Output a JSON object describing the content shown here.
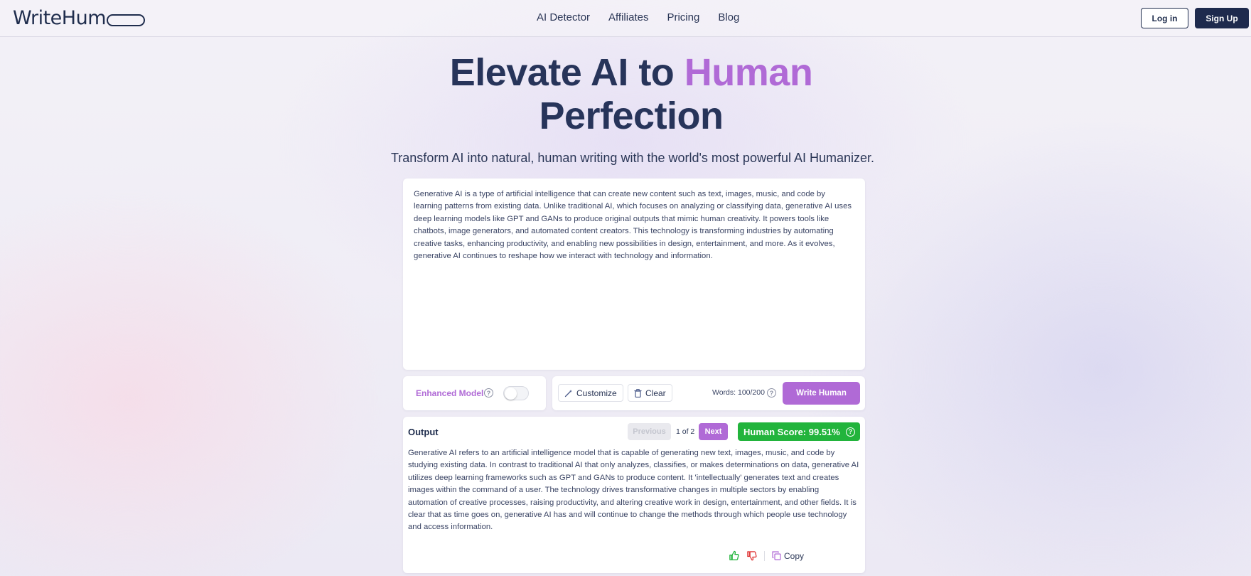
{
  "header": {
    "logo_text": "WriteHum",
    "nav": [
      "AI Detector",
      "Affiliates",
      "Pricing",
      "Blog"
    ],
    "login_label": "Log in",
    "signup_label": "Sign Up"
  },
  "hero": {
    "title_part1": "Elevate AI to ",
    "title_accent": "Human",
    "title_line2": "Perfection",
    "subtitle": "Transform AI into natural, human writing with the world's most powerful AI Humanizer."
  },
  "input": {
    "text": "Generative AI is a type of artificial intelligence that can create new content such as text, images, music, and code by learning patterns from existing data. Unlike traditional AI, which focuses on analyzing or classifying data, generative AI uses deep learning models like GPT and GANs to produce original outputs that mimic human creativity. It powers tools like chatbots, image generators, and automated content creators. This technology is transforming industries by automating creative tasks, enhancing productivity, and enabling new possibilities in design, entertainment, and more. As it evolves, generative AI continues to reshape how we interact with technology and information."
  },
  "controls": {
    "enhanced_label": "Enhanced Model",
    "enhanced_on": false,
    "customize_label": "Customize",
    "clear_label": "Clear",
    "words": "Words: 100/200",
    "write_label": "Write Human"
  },
  "output": {
    "title": "Output",
    "prev_label": "Previous",
    "pager": "1 of 2",
    "next_label": "Next",
    "score_label": "Human Score: 99.51%",
    "text": "Generative AI refers to an artificial intelligence model that is capable of generating new text, images, music, and code by studying existing data. In contrast to traditional AI that only analyzes, classifies, or makes determinations on data, generative AI utilizes deep learning frameworks such as GPT and GANs to produce content. It 'intellectually' generates text and creates images within the command of a user. The technology drives transformative changes in multiple sectors by enabling automation of creative processes, raising productivity, and altering creative work in design, entertainment, and other fields. It is clear that as time goes on, generative AI has and will continue to change the methods through which people use technology and access information.",
    "copy_label": "Copy"
  },
  "colors": {
    "accent": "#b06ad6",
    "navy": "#1e2a4d",
    "score_green": "#22b43c"
  }
}
